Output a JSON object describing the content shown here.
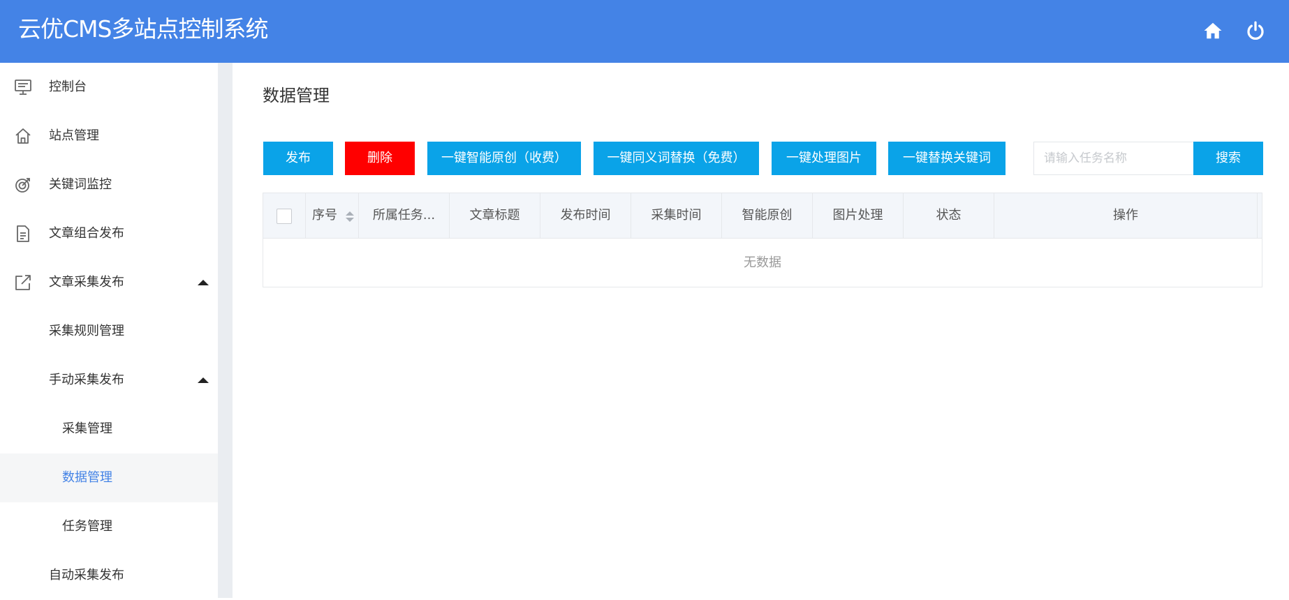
{
  "header": {
    "title": "云优CMS多站点控制系统",
    "home_icon": "home-icon",
    "power_icon": "power-icon",
    "bg_color": "#4483e6"
  },
  "sidebar": {
    "items": [
      {
        "label": "控制台",
        "icon": "monitor-icon"
      },
      {
        "label": "站点管理",
        "icon": "house-icon"
      },
      {
        "label": "关键词监控",
        "icon": "target-icon"
      },
      {
        "label": "文章组合发布",
        "icon": "document-icon"
      },
      {
        "label": "文章采集发布",
        "icon": "external-link-icon",
        "expanded": true
      },
      {
        "label": "采集规则管理"
      },
      {
        "label": "手动采集发布",
        "expanded": true
      },
      {
        "label": "采集管理"
      },
      {
        "label": "数据管理",
        "active": true
      },
      {
        "label": "任务管理"
      },
      {
        "label": "自动采集发布"
      }
    ]
  },
  "main": {
    "page_title": "数据管理",
    "toolbar": {
      "publish": "发布",
      "delete": "删除",
      "ai_original": "一键智能原创（收费）",
      "synonym_replace": "一键同义词替换（免费）",
      "process_images": "一键处理图片",
      "replace_keywords": "一键替换关键词",
      "search_placeholder": "请输入任务名称",
      "search_value": "",
      "search_button": "搜索"
    },
    "table": {
      "columns": [
        "序号",
        "所属任务...",
        "文章标题",
        "发布时间",
        "采集时间",
        "智能原创",
        "图片处理",
        "状态",
        "操作"
      ],
      "rows": [],
      "empty_text": "无数据"
    }
  },
  "colors": {
    "primary_button": "#0aa3e8",
    "danger_button": "#ff0000",
    "active_link": "#4483e6"
  }
}
